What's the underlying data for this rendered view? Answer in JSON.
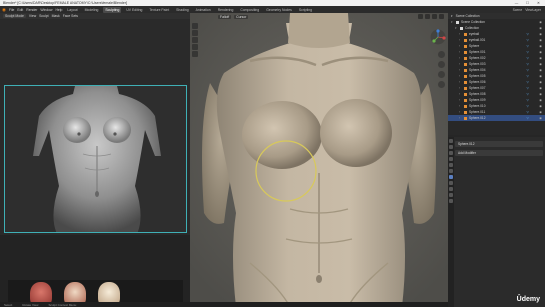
{
  "window": {
    "title": "Blender* [C:\\Users\\DAR\\Desktop\\FEMALE ANATOMY\\C:\\Users\\female\\Blender]",
    "controls": [
      "—",
      "☐",
      "✕"
    ]
  },
  "menubar": {
    "logo": "◉",
    "menus": [
      "File",
      "Edit",
      "Render",
      "Window",
      "Help"
    ],
    "tabs": [
      "Layout",
      "Modeling",
      "Sculpting",
      "UV Editing",
      "Texture Paint",
      "Shading",
      "Animation",
      "Rendering",
      "Compositing",
      "Geometry Nodes",
      "Scripting"
    ],
    "active_tab": "Sculpting",
    "scene_label": "Scene",
    "view_layer_label": "ViewLayer"
  },
  "ref_panel": {
    "mode": "Sculpt Mode",
    "buttons": [
      "View",
      "Sculpt",
      "Mask",
      "Face Sets"
    ]
  },
  "main_viewport": {
    "header_buttons": [
      "Falloff",
      "Cursor"
    ],
    "right_buttons": [
      "Overlays",
      "Options"
    ]
  },
  "outliner": {
    "header": "Scene Collection",
    "rows": [
      {
        "label": "Scene Collection",
        "indent": 0,
        "selected": false
      },
      {
        "label": "Collection",
        "indent": 1,
        "selected": false
      },
      {
        "label": "eyeball",
        "indent": 2,
        "selected": false
      },
      {
        "label": "eyeball.001",
        "indent": 2,
        "selected": false
      },
      {
        "label": "Sphere",
        "indent": 2,
        "selected": false
      },
      {
        "label": "Sphere.001",
        "indent": 2,
        "selected": false
      },
      {
        "label": "Sphere.002",
        "indent": 2,
        "selected": false
      },
      {
        "label": "Sphere.003",
        "indent": 2,
        "selected": false
      },
      {
        "label": "Sphere.004",
        "indent": 2,
        "selected": false
      },
      {
        "label": "Sphere.005",
        "indent": 2,
        "selected": false
      },
      {
        "label": "Sphere.006",
        "indent": 2,
        "selected": false
      },
      {
        "label": "Sphere.007",
        "indent": 2,
        "selected": false
      },
      {
        "label": "Sphere.008",
        "indent": 2,
        "selected": false
      },
      {
        "label": "Sphere.009",
        "indent": 2,
        "selected": false
      },
      {
        "label": "Sphere.010",
        "indent": 2,
        "selected": false
      },
      {
        "label": "Sphere.011",
        "indent": 2,
        "selected": false
      },
      {
        "label": "Sphere.012",
        "indent": 2,
        "selected": true
      }
    ]
  },
  "properties": {
    "object_name": "Sphere.012",
    "add_modifier": "Add Modifier"
  },
  "status_bar": {
    "items": [
      "Select",
      "Rotate View",
      "Sculpt Context Menu"
    ]
  },
  "watermark": "Ûdemy",
  "colors": {
    "accent": "#e87d0d",
    "selection": "#334d80",
    "ref_frame": "#3fb0b6",
    "brush_circle": "#d8c95a",
    "skin": "#b8ab97"
  }
}
